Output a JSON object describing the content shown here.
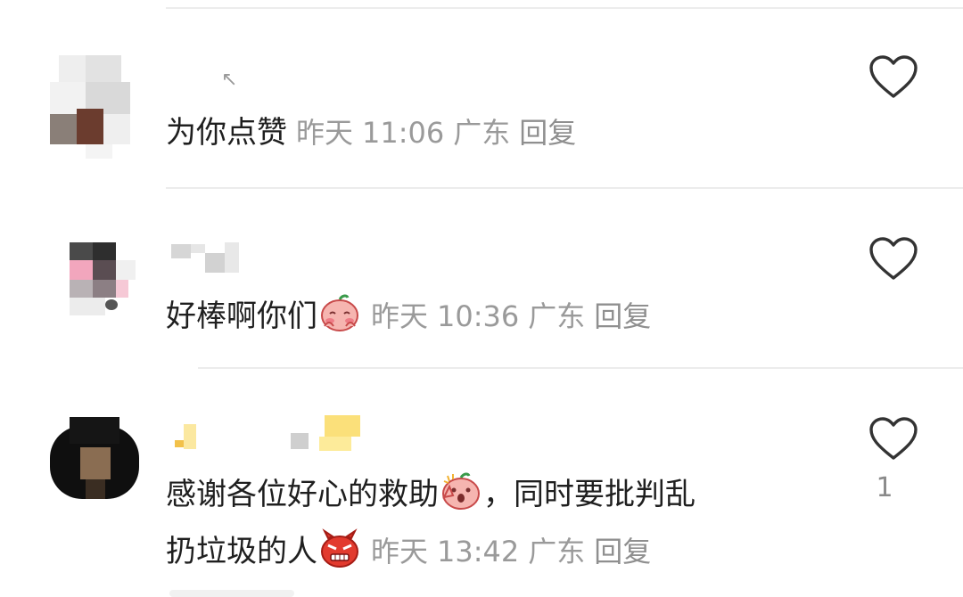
{
  "comments": [
    {
      "body": "为你点赞",
      "date": "昨天",
      "time": "11:06",
      "location": "广东",
      "reply_label": "回复",
      "like_count": ""
    },
    {
      "body": "好棒啊你们",
      "date": "昨天",
      "time": "10:36",
      "location": "广东",
      "reply_label": "回复",
      "like_count": ""
    },
    {
      "body_line1": "感谢各位好心的救助",
      "body_line1_suffix": "，同时要批判乱",
      "body_line2": "扔垃圾的人",
      "date": "昨天",
      "time": "13:42",
      "location": "广东",
      "reply_label": "回复",
      "like_count": "1"
    }
  ],
  "icons": {
    "like": "heart-outline-icon",
    "emoji_shy": "shy-face-emoji",
    "emoji_surprised": "surprised-face-emoji",
    "emoji_angry": "angry-face-emoji"
  },
  "colors": {
    "text": "#1f1f1f",
    "meta": "#9a9a9a",
    "divider": "#ececec"
  }
}
